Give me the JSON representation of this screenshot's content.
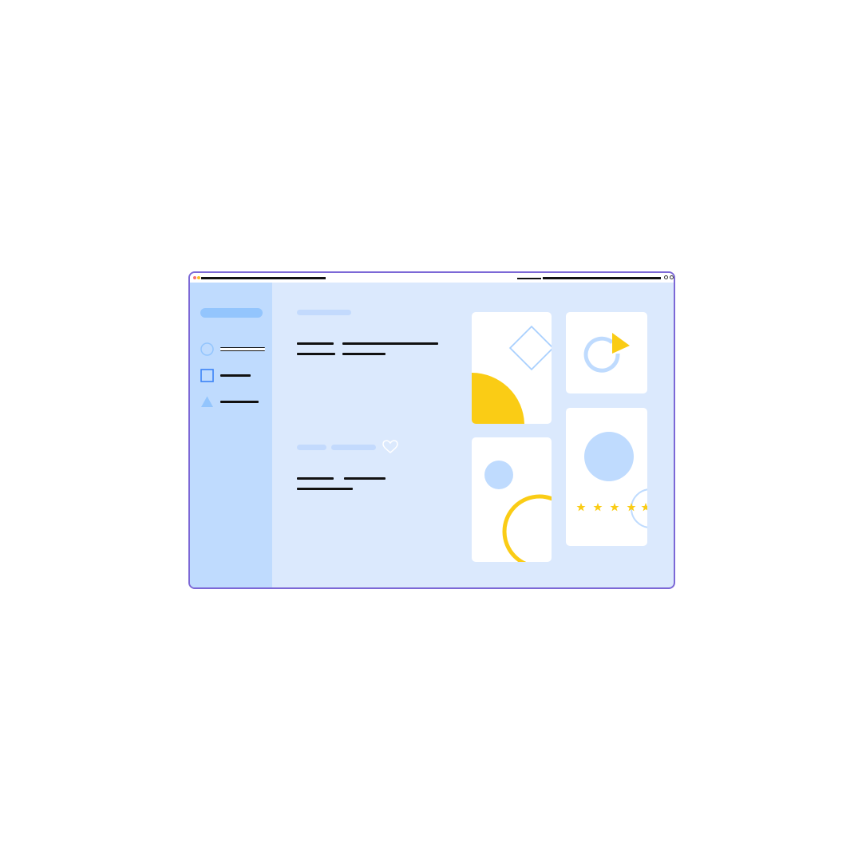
{
  "colors": {
    "window_border": "#7c68d6",
    "window_bg": "#dbe9fd",
    "sidebar_bg": "#bfdbfe",
    "accent_blue": "#93c5fd",
    "light_blue": "#bfdbfe",
    "yellow": "#facc15",
    "card_bg": "#ffffff"
  },
  "sidebar": {
    "items": [
      {
        "icon": "circle-icon",
        "active": true
      },
      {
        "icon": "square-icon",
        "active": false
      },
      {
        "icon": "triangle-icon",
        "active": false
      }
    ]
  },
  "main": {
    "sections": [
      {
        "icon": "none"
      },
      {
        "icon": "heart-icon"
      }
    ]
  },
  "cards": [
    {
      "illustration": "diamond-and-quarter-circle"
    },
    {
      "illustration": "rotate-arrow"
    },
    {
      "illustration": "circle-and-arc"
    },
    {
      "illustration": "circle-and-rating-stars",
      "rating": 5
    }
  ]
}
